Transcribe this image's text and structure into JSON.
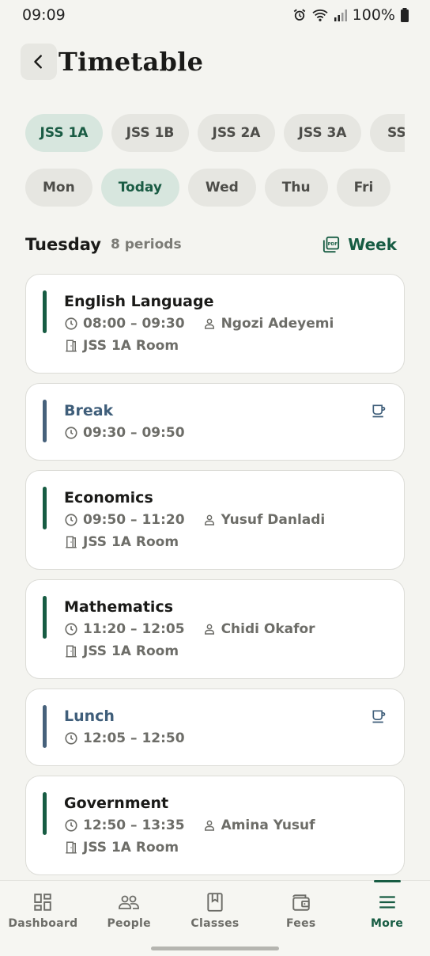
{
  "status": {
    "time": "09:09",
    "battery": "100%"
  },
  "header": {
    "title": "Timetable"
  },
  "class_chips": [
    {
      "label": "JSS 1A",
      "active": true
    },
    {
      "label": "JSS 1B",
      "active": false
    },
    {
      "label": "JSS 2A",
      "active": false
    },
    {
      "label": "JSS 3A",
      "active": false
    },
    {
      "label": "SS",
      "active": false
    }
  ],
  "day_chips": [
    {
      "label": "Mon",
      "active": false
    },
    {
      "label": "Today",
      "active": true
    },
    {
      "label": "Wed",
      "active": false
    },
    {
      "label": "Thu",
      "active": false
    },
    {
      "label": "Fri",
      "active": false
    }
  ],
  "day_header": {
    "day": "Tuesday",
    "periods": "8 periods",
    "week_label": "Week"
  },
  "periods": [
    {
      "type": "lesson",
      "subject": "English Language",
      "time": "08:00 – 09:30",
      "teacher": "Ngozi Adeyemi",
      "room": "JSS 1A Room"
    },
    {
      "type": "break",
      "subject": "Break",
      "time": "09:30 – 09:50"
    },
    {
      "type": "lesson",
      "subject": "Economics",
      "time": "09:50 – 11:20",
      "teacher": "Yusuf Danladi",
      "room": "JSS 1A Room"
    },
    {
      "type": "lesson",
      "subject": "Mathematics",
      "time": "11:20 – 12:05",
      "teacher": "Chidi Okafor",
      "room": "JSS 1A Room"
    },
    {
      "type": "break",
      "subject": "Lunch",
      "time": "12:05 – 12:50"
    },
    {
      "type": "lesson",
      "subject": "Government",
      "time": "12:50 – 13:35",
      "teacher": "Amina Yusuf",
      "room": "JSS 1A Room"
    }
  ],
  "nav": [
    {
      "label": "Dashboard",
      "icon": "dashboard-icon",
      "active": false
    },
    {
      "label": "People",
      "icon": "people-icon",
      "active": false
    },
    {
      "label": "Classes",
      "icon": "book-icon",
      "active": false
    },
    {
      "label": "Fees",
      "icon": "wallet-icon",
      "active": false
    },
    {
      "label": "More",
      "icon": "menu-icon",
      "active": true
    }
  ],
  "colors": {
    "accent": "#175c43",
    "break": "#46617b",
    "background": "#f4f4f0"
  }
}
